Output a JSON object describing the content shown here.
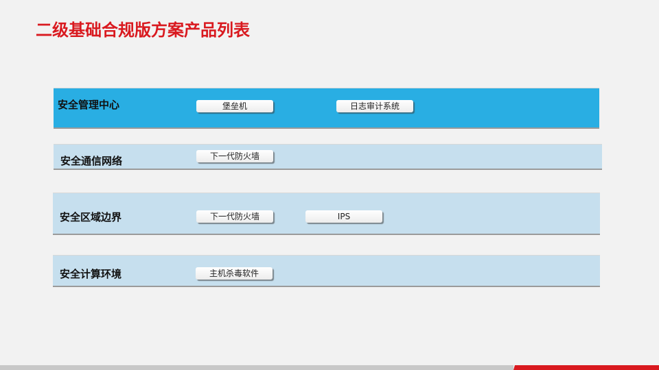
{
  "title": "二级基础合规版方案产品列表",
  "colors": {
    "title": "#d9191f",
    "band_highlight": "#29aee3",
    "band_normal": "#c6dfee",
    "footer_red": "#d9191f",
    "footer_gray": "#c8c8c8"
  },
  "rows": [
    {
      "label": "安全管理中心",
      "highlighted": true,
      "products": [
        "堡垒机",
        "日志审计系统"
      ]
    },
    {
      "label": "安全通信网络",
      "highlighted": false,
      "products": [
        "下一代防火墙"
      ]
    },
    {
      "label": "安全区域边界",
      "highlighted": false,
      "products": [
        "下一代防火墙",
        "IPS"
      ]
    },
    {
      "label": "安全计算环境",
      "highlighted": false,
      "products": [
        "主机杀毒软件"
      ]
    }
  ]
}
